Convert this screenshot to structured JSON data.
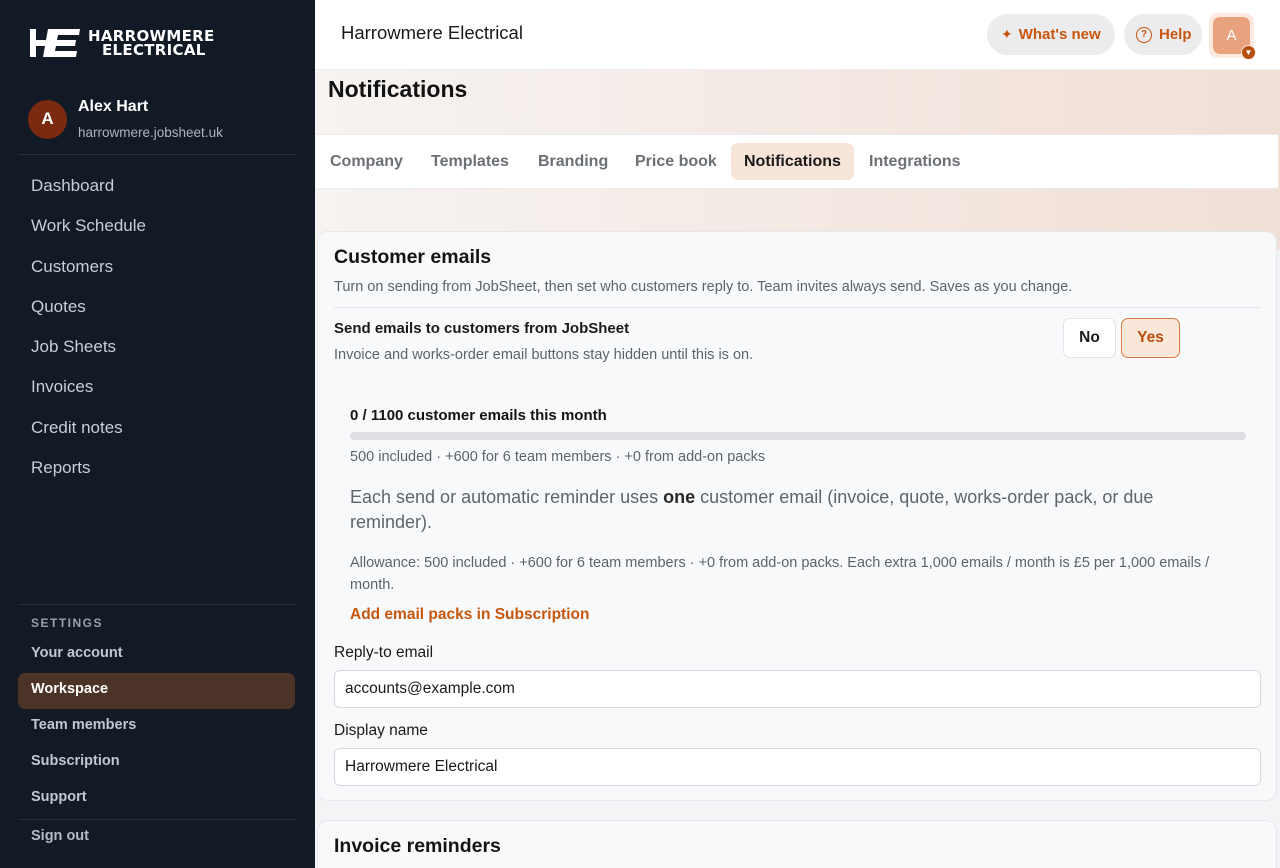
{
  "brand": {
    "line1": "HARROWMERE",
    "line2": "ELECTRICAL",
    "mark": "HE"
  },
  "user": {
    "initial": "A",
    "name": "Alex Hart",
    "domain": "harrowmere.jobsheet.uk"
  },
  "nav": [
    "Dashboard",
    "Work Schedule",
    "Customers",
    "Quotes",
    "Job Sheets",
    "Invoices",
    "Credit notes",
    "Reports"
  ],
  "settings": {
    "label": "SETTINGS",
    "items": [
      "Your account",
      "Workspace",
      "Team members",
      "Subscription",
      "Support"
    ],
    "active": "Workspace"
  },
  "signout": "Sign out",
  "header": {
    "title": "Harrowmere Electrical",
    "whats_new": "What's new",
    "help": "Help",
    "avatar_initial": "A"
  },
  "page": {
    "title": "Notifications",
    "tabs": [
      "Company",
      "Templates",
      "Branding",
      "Price book",
      "Notifications",
      "Integrations"
    ],
    "active_tab": "Notifications"
  },
  "customer_emails": {
    "title": "Customer emails",
    "subtitle": "Turn on sending from JobSheet, then set who customers reply to. Team invites always send. Saves as you change.",
    "send_title": "Send emails to customers from JobSheet",
    "send_desc": "Invoice and works-order email buttons stay hidden until this is on.",
    "no_label": "No",
    "yes_label": "Yes",
    "selected": "Yes",
    "usage_title": "0 / 1100 customer emails this month",
    "usage_fraction": 0,
    "usage_breakdown": "500 included · +600 for 6 team members · +0 from add-on packs",
    "send_info_pre": "Each send or automatic reminder uses ",
    "send_info_bold": "one",
    "send_info_post": " customer email (invoice, quote, works-order pack, or due reminder).",
    "allowance": "Allowance: 500 included · +600 for 6 team members · +0 from add-on packs. Each extra 1,000 emails / month is £5 per 1,000 emails / month.",
    "add_packs": "Add email packs in Subscription",
    "reply_to_label": "Reply-to email",
    "reply_to_value": "accounts@example.com",
    "display_name_label": "Display name",
    "display_name_value": "Harrowmere Electrical"
  },
  "invoice_reminders": {
    "title": "Invoice reminders"
  },
  "colors": {
    "sidebar": "#121a26",
    "accent": "#c8560c",
    "active_tab": "#f8e5da"
  }
}
